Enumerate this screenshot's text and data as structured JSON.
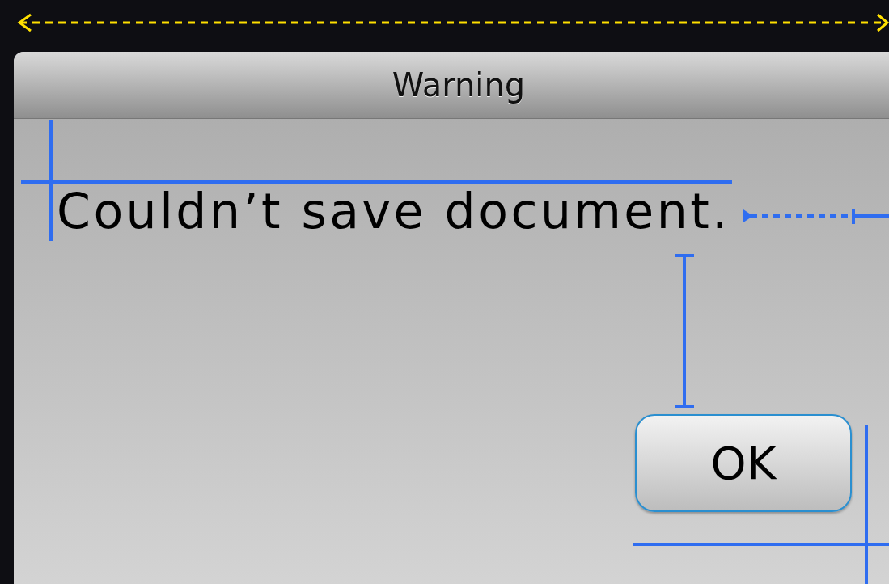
{
  "dialog": {
    "title": "Warning",
    "message": "Couldn’t save document.",
    "buttons": [
      {
        "label": "OK",
        "focused": true
      }
    ]
  }
}
